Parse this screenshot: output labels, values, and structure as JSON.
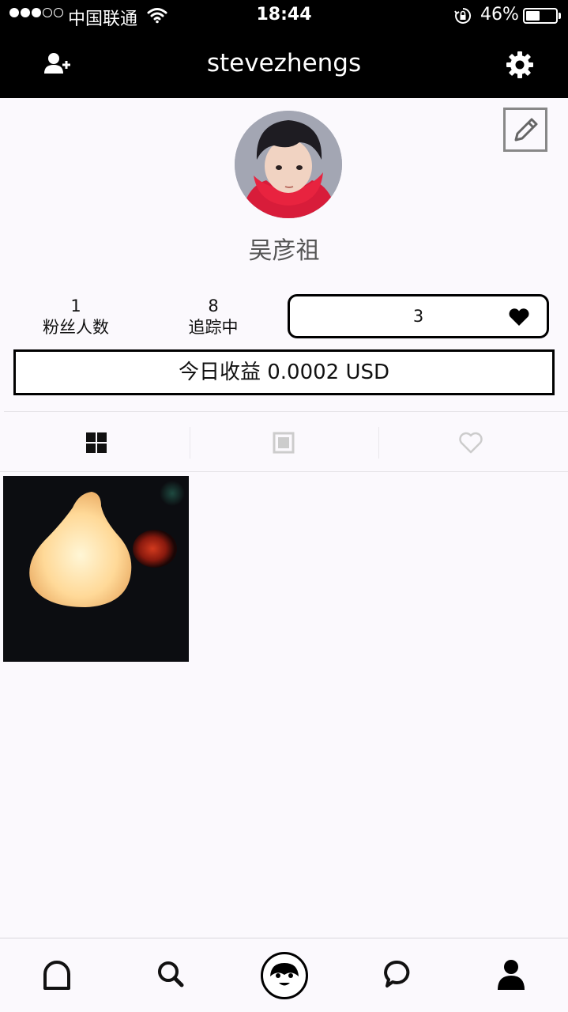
{
  "status_bar": {
    "carrier": "中国联通",
    "time": "18:44",
    "battery_percent_text": "46%",
    "battery_level": 0.46,
    "signal_bars_filled": 3,
    "signal_bars_total": 5,
    "icons": [
      "wifi-icon",
      "rotation-lock-icon",
      "battery-icon"
    ]
  },
  "header": {
    "username": "stevezhengs",
    "left_icon": "add-user-icon",
    "right_icon": "gear-icon"
  },
  "profile": {
    "display_name": "吴彦祖",
    "edit_icon": "pencil-icon",
    "followers": {
      "count": "1",
      "label": "粉丝人数"
    },
    "following": {
      "count": "8",
      "label": "追踪中"
    },
    "likes": {
      "count": "3",
      "icon": "heart-icon"
    },
    "earnings": "今日收益 0.0002 USD"
  },
  "tabs": [
    {
      "name": "grid",
      "icon": "grid-icon",
      "active": true
    },
    {
      "name": "single",
      "icon": "square-icon",
      "active": false
    },
    {
      "name": "liked",
      "icon": "heart-outline-icon",
      "active": false
    }
  ],
  "posts": [
    {
      "subject": "glowing-lamp-photo"
    }
  ],
  "bottom_nav": [
    {
      "name": "home",
      "icon": "home-icon"
    },
    {
      "name": "search",
      "icon": "search-icon"
    },
    {
      "name": "camera",
      "icon": "camera-face-icon"
    },
    {
      "name": "messages",
      "icon": "chat-bubble-icon"
    },
    {
      "name": "profile",
      "icon": "profile-icon"
    }
  ],
  "colors": {
    "header_bg": "#000000",
    "page_bg": "#fbf9fd",
    "muted_icon": "#cccccc"
  }
}
